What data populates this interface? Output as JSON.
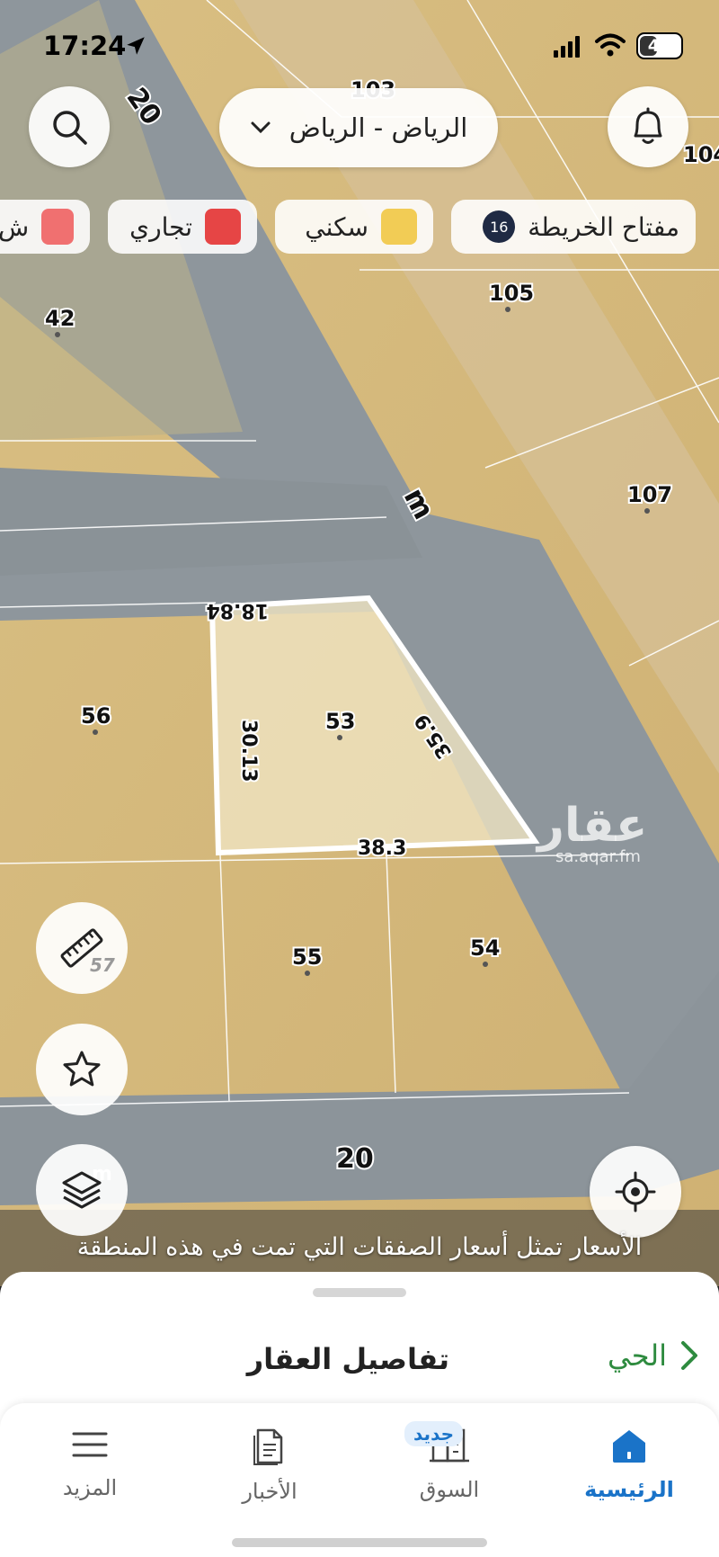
{
  "status": {
    "time": "17:24",
    "battery": "44",
    "battery_level": 0.44
  },
  "header": {
    "city": "الرياض - الرياض"
  },
  "legend": {
    "key_label": "مفتاح الخريطة",
    "key_count": "16",
    "items": [
      {
        "label": "سكني",
        "color": "#f2cc55"
      },
      {
        "label": "تجاري",
        "color": "#e64545"
      },
      {
        "label": "ش",
        "color": "#f07070"
      }
    ]
  },
  "map": {
    "street_labels": [
      "20",
      "m",
      "20"
    ],
    "parcels": [
      "103",
      "104",
      "105",
      "42",
      "107",
      "56",
      "53",
      "55",
      "54"
    ],
    "dimensions": {
      "top": "18.84",
      "left": "30.13",
      "right": "35.9",
      "bottom": "38.3"
    },
    "watermark": "عقار",
    "watermark_url": "sa.aqar.fm",
    "ruler_count": "57",
    "m_mark": "m"
  },
  "notice": "الأسعار تمثل أسعار الصفقات التي تمت في هذه المنطقة",
  "sheet": {
    "title": "تفاصيل العقار",
    "neighborhood": "الحي"
  },
  "tabs": [
    {
      "label": "الرئيسية"
    },
    {
      "label": "السوق",
      "badge": "جديد"
    },
    {
      "label": "الأخبار"
    },
    {
      "label": "المزيد"
    }
  ]
}
